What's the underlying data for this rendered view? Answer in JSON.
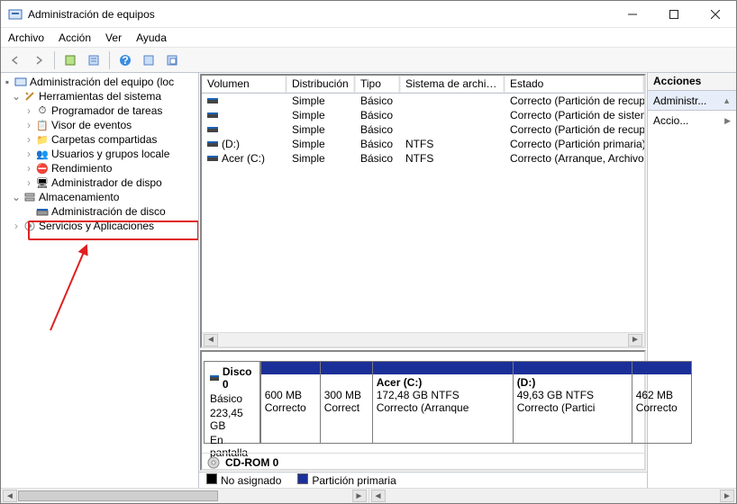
{
  "title": "Administración de equipos",
  "menu": {
    "archivo": "Archivo",
    "accion": "Acción",
    "ver": "Ver",
    "ayuda": "Ayuda"
  },
  "tree": {
    "root": "Administración del equipo (loc",
    "tools": "Herramientas del sistema",
    "items": [
      "Programador de tareas",
      "Visor de eventos",
      "Carpetas compartidas",
      "Usuarios y grupos locale",
      "Rendimiento",
      "Administrador de dispo"
    ],
    "storage": "Almacenamiento",
    "diskmgmt": "Administración de disco",
    "services": "Servicios y Aplicaciones"
  },
  "columns": {
    "volumen": "Volumen",
    "distribucion": "Distribución",
    "tipo": "Tipo",
    "fs": "Sistema de archivos",
    "estado": "Estado"
  },
  "rows": [
    {
      "v": "",
      "d": "Simple",
      "t": "Básico",
      "fs": "",
      "e": "Correcto (Partición de recuperación)"
    },
    {
      "v": "",
      "d": "Simple",
      "t": "Básico",
      "fs": "",
      "e": "Correcto (Partición de sistema EFI)"
    },
    {
      "v": "",
      "d": "Simple",
      "t": "Básico",
      "fs": "",
      "e": "Correcto (Partición de recuperación)"
    },
    {
      "v": "(D:)",
      "d": "Simple",
      "t": "Básico",
      "fs": "NTFS",
      "e": "Correcto (Partición primaria)"
    },
    {
      "v": "Acer (C:)",
      "d": "Simple",
      "t": "Básico",
      "fs": "NTFS",
      "e": "Correcto (Arranque, Archivo de pagina"
    }
  ],
  "disk": {
    "name": "Disco 0",
    "type": "Básico",
    "size": "223,45 GB",
    "status": "En pantalla",
    "parts": [
      {
        "title": "",
        "size": "600 MB",
        "status": "Correcto"
      },
      {
        "title": "",
        "size": "300 MB",
        "status": "Correct"
      },
      {
        "title": "Acer  (C:)",
        "size": "172,48 GB NTFS",
        "status": "Correcto (Arranque"
      },
      {
        "title": "(D:)",
        "size": "49,63 GB NTFS",
        "status": "Correcto (Partici"
      },
      {
        "title": "",
        "size": "462 MB",
        "status": "Correcto"
      }
    ],
    "cdrom": "CD-ROM 0"
  },
  "legend": {
    "unalloc": "No asignado",
    "primary": "Partición primaria"
  },
  "actions": {
    "head": "Acciones",
    "a": "Administr...",
    "b": "Accio..."
  }
}
